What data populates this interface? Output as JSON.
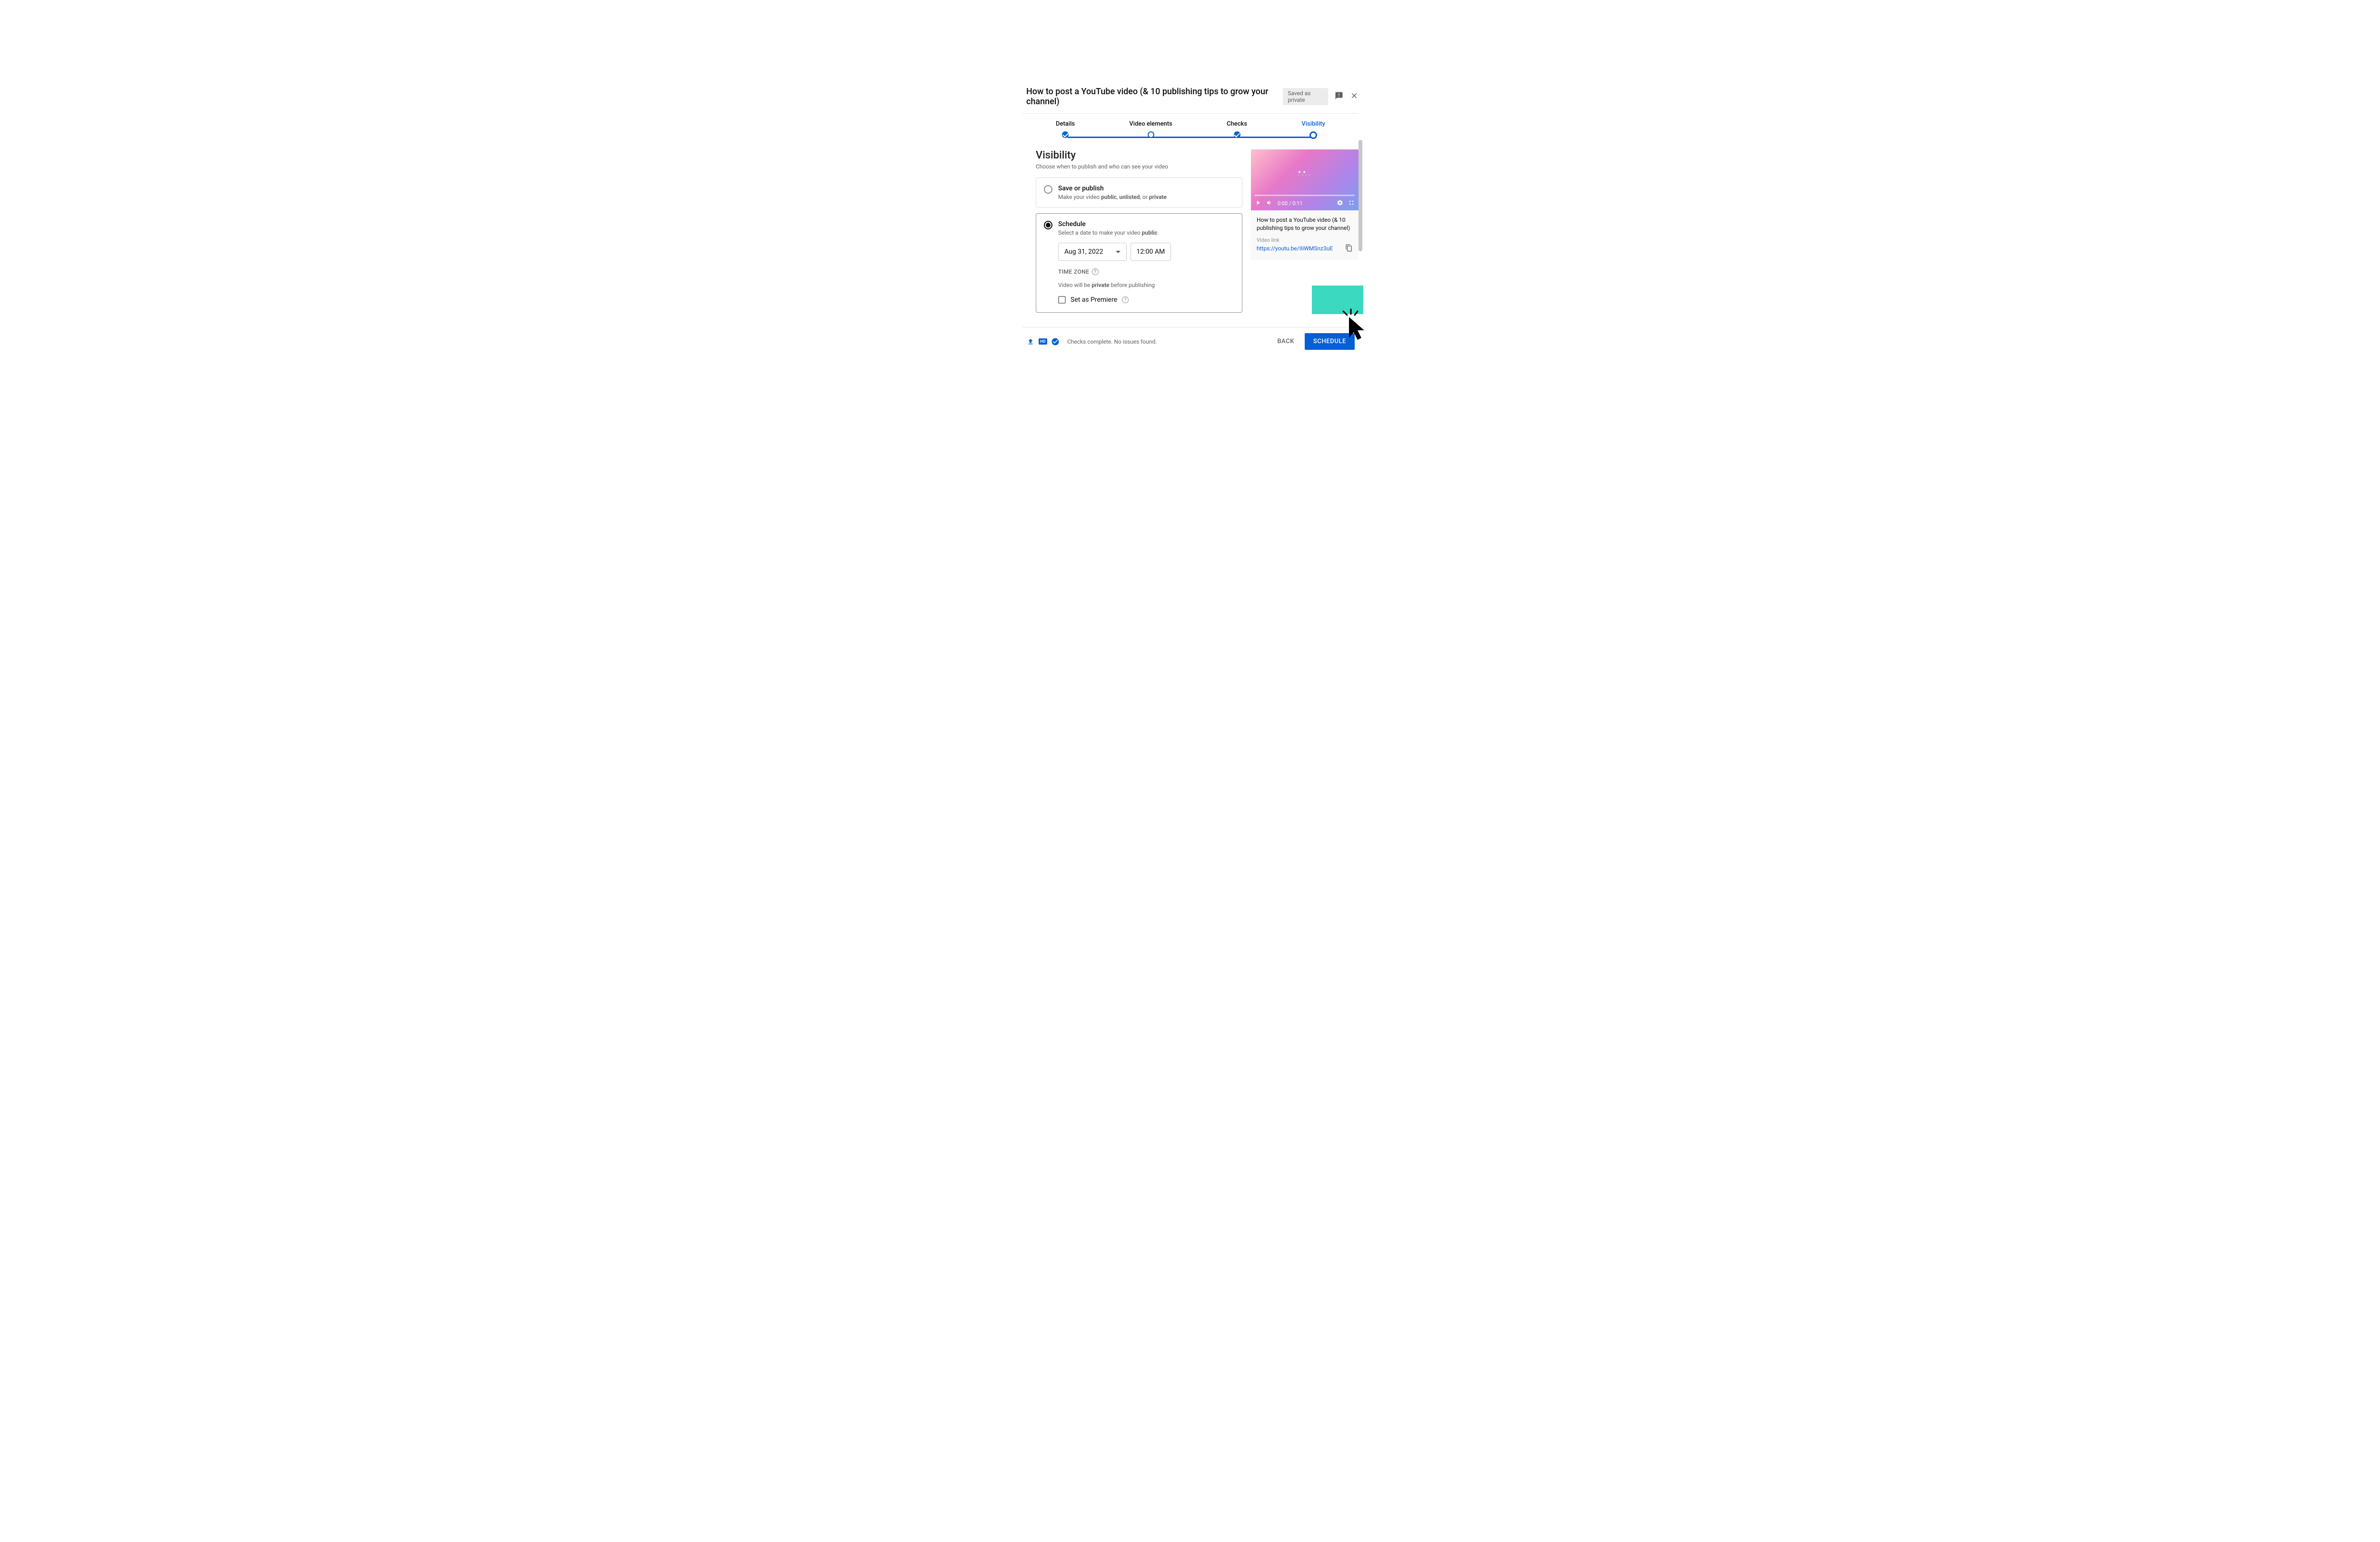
{
  "header": {
    "title": "How to post a YouTube video (& 10 publishing tips to grow your channel)",
    "saved_status": "Saved as private"
  },
  "stepper": {
    "steps": [
      "Details",
      "Video elements",
      "Checks",
      "Visibility"
    ],
    "active_index": 3
  },
  "visibility": {
    "heading": "Visibility",
    "subheading": "Choose when to publish and who can see your video",
    "save_publish": {
      "title": "Save or publish",
      "desc_prefix": "Make your video ",
      "desc_b1": "public",
      "desc_sep1": ", ",
      "desc_b2": "unlisted",
      "desc_sep2": ", or ",
      "desc_b3": "private"
    },
    "schedule": {
      "title": "Schedule",
      "desc_prefix": "Select a date to make your video ",
      "desc_bold": "public",
      "date": "Aug 31, 2022",
      "time": "12:00 AM",
      "tz_label": "TIME ZONE",
      "note_prefix": "Video will be ",
      "note_bold": "private",
      "note_suffix": " before publishing",
      "premiere_label": "Set as Premiere"
    }
  },
  "preview": {
    "time_display": "0:00 / 0:11",
    "title": "How to post a YouTube video (& 10 publishing tips to grow your channel)",
    "link_label": "Video link",
    "link": "https://youtu.be/IIiWMSnz3uE"
  },
  "footer": {
    "hd_label": "HD",
    "status": "Checks complete. No issues found.",
    "back_label": "BACK",
    "schedule_label": "SCHEDULE"
  }
}
